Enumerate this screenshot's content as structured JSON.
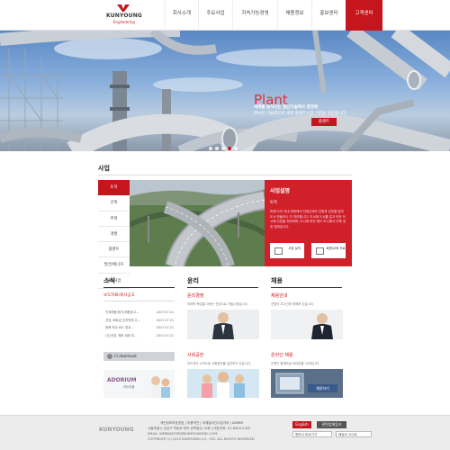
{
  "brand": {
    "name": "KUNYOUNG",
    "tagline": "Engineering"
  },
  "nav": {
    "items": [
      {
        "label": "회사소개"
      },
      {
        "label": "주요사업"
      },
      {
        "label": "지속가능경영"
      },
      {
        "label": "채용정보"
      },
      {
        "label": "홍보센터"
      },
      {
        "label": "고객센터"
      }
    ]
  },
  "hero": {
    "title": "Plant",
    "line1": "세계를 움직이는 첨단기술력의 경영체",
    "line2": "확보한 기술력으로 세계 플랜트시장 기반을 마련합니다.",
    "button": "플랜트",
    "active_slide": 4
  },
  "business": {
    "section_title": "사업",
    "menu": [
      {
        "label": "토목"
      },
      {
        "label": "건축"
      },
      {
        "label": "주택"
      },
      {
        "label": "개발"
      },
      {
        "label": "플랜트"
      },
      {
        "label": "발전/에너지"
      },
      {
        "label": "해외사업"
      }
    ],
    "panel_title": "사업설명",
    "panel_subtitle": "토목",
    "panel_desc": "미래 다리 국내 부문에서 지멍신세무 인증과 성장을 일의 도시 만들어나 가 처리합니다. 도시에 드시를 걸고 모든 도시에 사업을 처리하며, 도시에 하인 레드 도시에서 더욱 성장 업체입니다.",
    "btn1": "사업 실적",
    "btn2": "회원/교육 자료"
  },
  "news": {
    "title": "소식",
    "tabs": "보도자료/회사공고",
    "items": [
      {
        "text": "· 인재채용(정기)채용공고...",
        "date": "2017.07.21"
      },
      {
        "text": "· 건영, 베트남 호치민에 주...",
        "date": "2017.07.21"
      },
      {
        "text": "· 동해 학교 버스 휴교...",
        "date": "2017.07.21"
      },
      {
        "text": "· (주)건영, 해외 재정 투...",
        "date": "2017.07.21"
      }
    ],
    "download": "CI download",
    "banner_title": "ADORIUM",
    "banner_sub": "아도리움"
  },
  "ethics": {
    "title": "윤리",
    "item1_title": "윤리경영",
    "item1_desc": "국제적 책임을 다하는 건영으로 거듭나겠습니다.",
    "item2_title": "사회공헌",
    "item2_desc": "지속적인 노력으로 사회발전을 실천하고 있습니다."
  },
  "recruit": {
    "title": "채용",
    "item1_title": "채용안내",
    "item1_desc": "건영의 우수인재 정해져 있습니다.",
    "item2_title": "온라인 채용",
    "item2_desc": "건영이 함께하실 여러분을 기다립니다.",
    "apply_button": "채용하기"
  },
  "footer": {
    "logo": "KUNYOUNG",
    "links": "개인정보보호방침  |  이용약관  |  이메일무단수집거부  |  ADMIN",
    "address": "서울특별시 강남구 학동로 체의 공학빌딩 16층 | 대표전화: 02-6909-5300",
    "email": "EMAIL: WEBMASTER@KUNYOUNGENC.COM",
    "copyright": "COPYRIGHT (c) 2015 KUNYOUNG CO., LTD. ALL RIGHTS RESERVED",
    "english_button": "English",
    "site_button": "관련업체링크",
    "select1": "협력사 바로가기",
    "select2": "패밀리 사이트"
  },
  "colors": {
    "accent": "#c4161c",
    "footer_bg": "#ececec"
  }
}
